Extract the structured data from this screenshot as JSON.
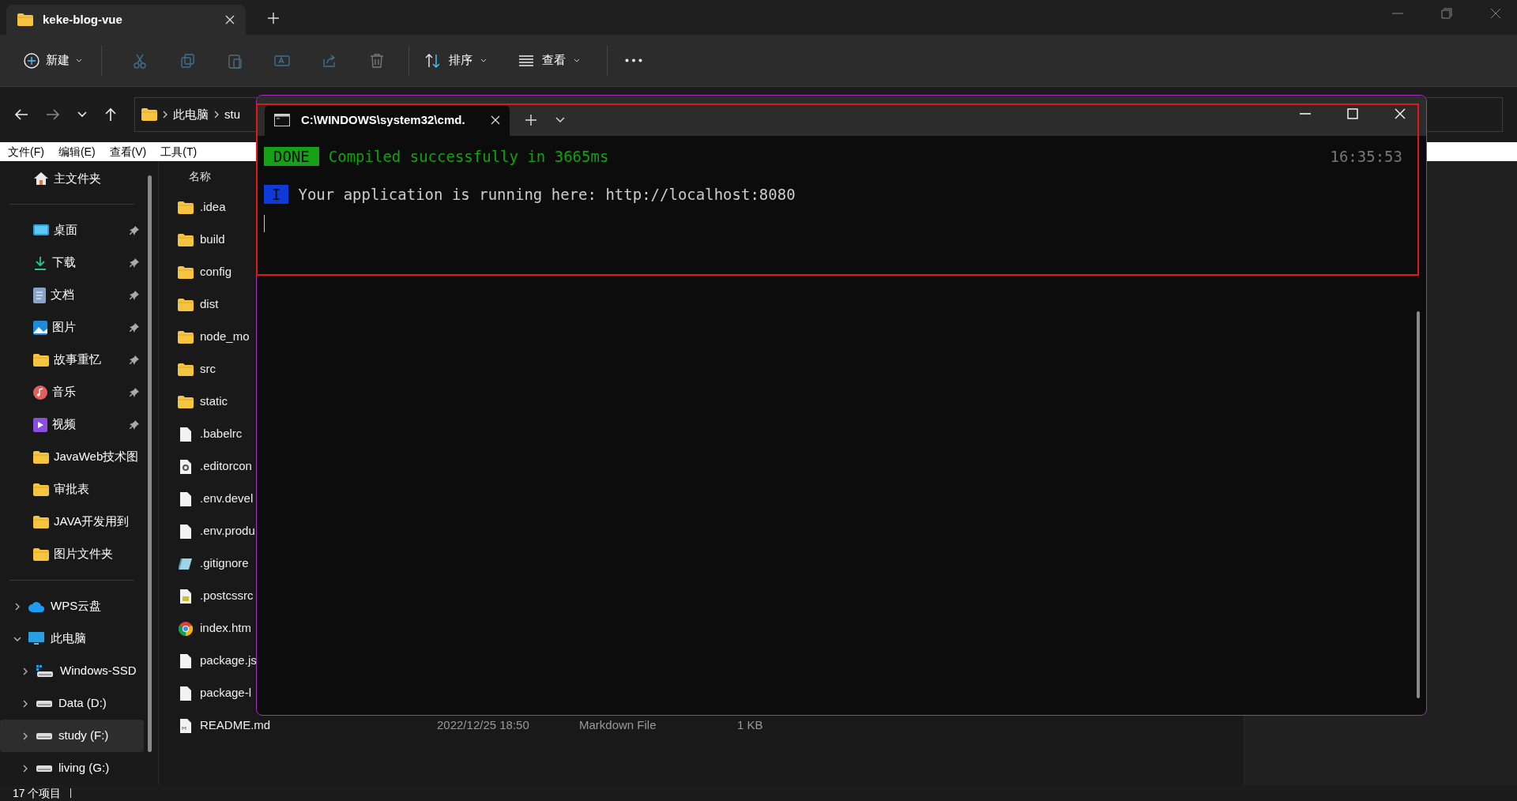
{
  "explorer": {
    "tab": {
      "title": "keke-blog-vue"
    },
    "toolbar": [
      {
        "kind": "new",
        "label": "新建"
      },
      {
        "kind": "cut"
      },
      {
        "kind": "copy"
      },
      {
        "kind": "paste"
      },
      {
        "kind": "rename"
      },
      {
        "kind": "share"
      },
      {
        "kind": "delete"
      },
      {
        "kind": "sort",
        "label": "排序"
      },
      {
        "kind": "view",
        "label": "查看"
      },
      {
        "kind": "more"
      }
    ],
    "breadcrumbs": [
      "此电脑",
      "stu"
    ],
    "menu": [
      "文件(F)",
      "编辑(E)",
      "查看(V)",
      "工具(T)"
    ],
    "sidebar": {
      "home": "主文件夹",
      "quick": [
        {
          "kind": "desktop",
          "label": "桌面",
          "pinned": true
        },
        {
          "kind": "download",
          "label": "下载",
          "pinned": true
        },
        {
          "kind": "document",
          "label": "文档",
          "pinned": true
        },
        {
          "kind": "pictures",
          "label": "图片",
          "pinned": true
        },
        {
          "kind": "folder",
          "label": "故事重忆",
          "pinned": true
        },
        {
          "kind": "music",
          "label": "音乐",
          "pinned": true
        },
        {
          "kind": "video",
          "label": "视频",
          "pinned": true
        },
        {
          "kind": "folder",
          "label": "JavaWeb技术图",
          "pinned": false
        },
        {
          "kind": "folder",
          "label": "审批表",
          "pinned": false
        },
        {
          "kind": "folder",
          "label": "JAVA开发用到",
          "pinned": false
        },
        {
          "kind": "folder",
          "label": "图片文件夹",
          "pinned": false
        }
      ],
      "tree": [
        {
          "kind": "cloud",
          "label": "WPS云盘",
          "expanded": false,
          "selected": false
        },
        {
          "kind": "pc",
          "label": "此电脑",
          "expanded": true,
          "selected": false,
          "children": [
            {
              "kind": "windrive",
              "label": "Windows-SSD",
              "expanded": false,
              "selected": false
            },
            {
              "kind": "drive",
              "label": "Data (D:)",
              "expanded": false,
              "selected": false
            },
            {
              "kind": "drive",
              "label": "study (F:)",
              "expanded": false,
              "selected": true
            },
            {
              "kind": "drive",
              "label": "living (G:)",
              "expanded": false,
              "selected": false
            }
          ]
        }
      ]
    },
    "files": {
      "column_name": "名称",
      "rows": [
        {
          "kind": "folder",
          "name": ".idea"
        },
        {
          "kind": "folder",
          "name": "build"
        },
        {
          "kind": "folder",
          "name": "config"
        },
        {
          "kind": "folder",
          "name": "dist"
        },
        {
          "kind": "folder",
          "name": "node_mo"
        },
        {
          "kind": "folder",
          "name": "src"
        },
        {
          "kind": "folder",
          "name": "static"
        },
        {
          "kind": "file",
          "name": ".babelrc"
        },
        {
          "kind": "settings",
          "name": ".editorcon"
        },
        {
          "kind": "file",
          "name": ".env.devel"
        },
        {
          "kind": "file",
          "name": ".env.produ"
        },
        {
          "kind": "gitignore",
          "name": ".gitignore"
        },
        {
          "kind": "js",
          "name": ".postcssrc"
        },
        {
          "kind": "chrome",
          "name": "index.htm"
        },
        {
          "kind": "file",
          "name": "package.js"
        },
        {
          "kind": "file",
          "name": "package-l"
        },
        {
          "kind": "markdown",
          "name": "README.md",
          "date": "2022/12/25 18:50",
          "type": "Markdown File",
          "size": "1 KB"
        }
      ]
    },
    "status_bar": "17 个项目"
  },
  "terminal": {
    "tab_title": "C:\\WINDOWS\\system32\\cmd.",
    "lines": [
      {
        "kind": "success",
        "badge": "DONE",
        "color": "#16a016",
        "text": "Compiled successfully in 3665ms",
        "time": "16:35:53"
      },
      {
        "kind": "info",
        "badge": "I",
        "color": "#0f3ad8",
        "text": "Your application is running here: http://localhost:8080"
      }
    ],
    "highlighted": true
  }
}
